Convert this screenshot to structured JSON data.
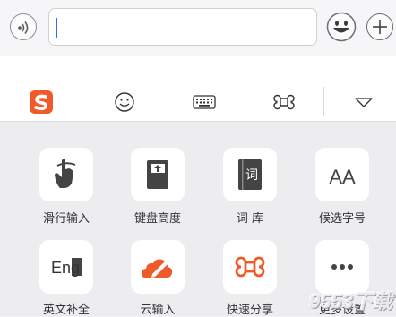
{
  "input_bar": {
    "voice_icon": "voice-icon",
    "emoji_icon": "emoji-icon",
    "plus_icon": "plus-icon",
    "text_value": ""
  },
  "toolbar": {
    "items": [
      {
        "name": "sogou-logo",
        "icon": "sogou-s-logo"
      },
      {
        "name": "emoticon",
        "icon": "smiley-icon"
      },
      {
        "name": "keyboard",
        "icon": "keyboard-icon"
      },
      {
        "name": "command",
        "icon": "command-icon"
      },
      {
        "name": "collapse",
        "icon": "triangle-down-icon"
      }
    ],
    "brand_color": "#f05a28"
  },
  "tiles": [
    {
      "label": "滑行输入",
      "icon": "swipe-hand-icon"
    },
    {
      "label": "键盘高度",
      "icon": "keyboard-height-icon"
    },
    {
      "label": "词 库",
      "icon": "dictionary-icon",
      "glyph": "词"
    },
    {
      "label": "候选字号",
      "icon": "font-size-icon",
      "glyph": "AA"
    },
    {
      "label": "英文补全",
      "icon": "english-complete-icon",
      "glyph": "Eng"
    },
    {
      "label": "云输入",
      "icon": "cloud-input-icon"
    },
    {
      "label": "快速分享",
      "icon": "quick-share-icon"
    },
    {
      "label": "更多设置",
      "icon": "more-dots-icon"
    }
  ],
  "watermark": "9553下载"
}
